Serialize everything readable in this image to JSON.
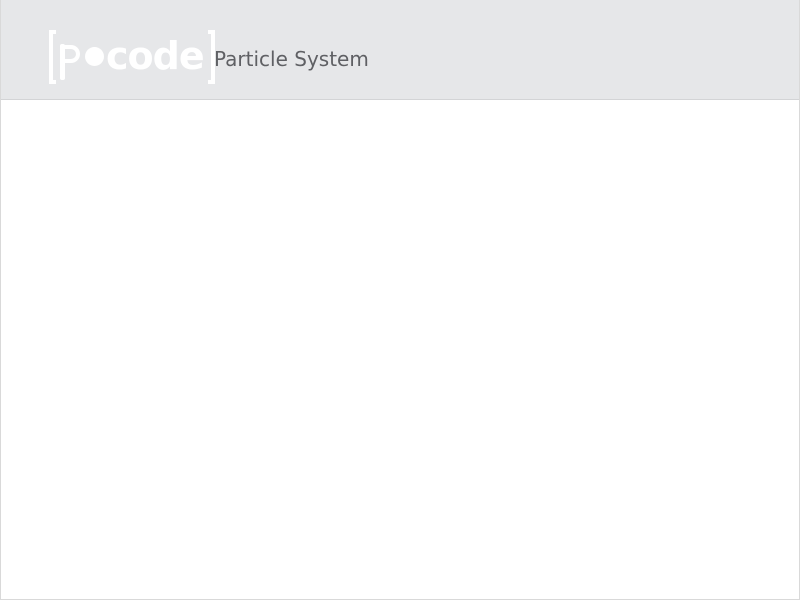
{
  "header": {
    "logo": {
      "letter_p": "p",
      "text": "code"
    },
    "title": "Particle System"
  },
  "colors": {
    "header_background": "#e6e7e9",
    "header_border": "#d3d4d6",
    "logo": "#ffffff",
    "title_text": "#5f6064",
    "canvas_background": "#ffffff",
    "frame_border": "#d9d9d9"
  }
}
